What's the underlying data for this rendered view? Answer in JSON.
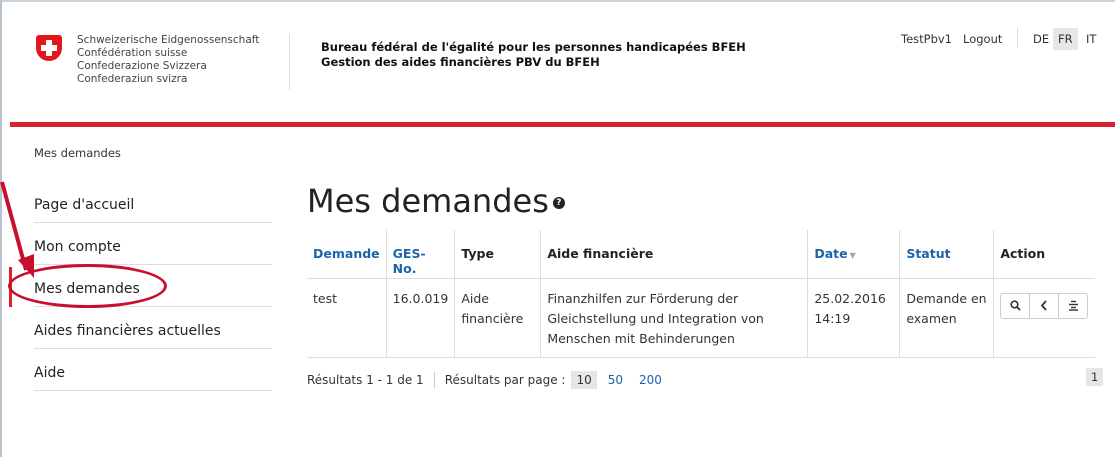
{
  "header": {
    "confederation": [
      "Schweizerische Eidgenossenschaft",
      "Confédération suisse",
      "Confederazione Svizzera",
      "Confederaziun svizra"
    ],
    "office_line1": "Bureau fédéral de l'égalité pour les personnes handicapées BFEH",
    "office_line2": "Gestion des aides financières PBV du BFEH",
    "user": "TestPbv1",
    "logout": "Logout",
    "languages": [
      "DE",
      "FR",
      "IT"
    ],
    "active_language": "FR"
  },
  "breadcrumb": "Mes demandes",
  "sidebar": {
    "items": [
      {
        "label": "Page d'accueil"
      },
      {
        "label": "Mon compte"
      },
      {
        "label": "Mes demandes"
      },
      {
        "label": "Aides financières actuelles"
      },
      {
        "label": "Aide"
      }
    ],
    "active_index": 2
  },
  "main": {
    "title": "Mes demandes",
    "help_icon": "question-circle-icon",
    "table": {
      "headers": [
        "Demande",
        "GES-No.",
        "Type",
        "Aide financière",
        "Date",
        "Statut",
        "Action"
      ],
      "rows": [
        {
          "demande": "test",
          "ges_no": "16.0.019",
          "type": "Aide financière",
          "aide": "Finanzhilfen zur Förderung der Gleichstellung und Integration von Menschen mit Behinderungen",
          "date": "25.02.2016 14:19",
          "statut": "Demande en examen"
        }
      ]
    },
    "footer": {
      "results": "Résultats 1 - 1 de 1",
      "per_page_label": "Résultats par page :",
      "per_page_options": [
        "10",
        "50",
        "200"
      ],
      "per_page_selected": "10",
      "page": "1"
    }
  },
  "colors": {
    "accent_red": "#d8232a",
    "link_blue": "#1b64ab"
  }
}
